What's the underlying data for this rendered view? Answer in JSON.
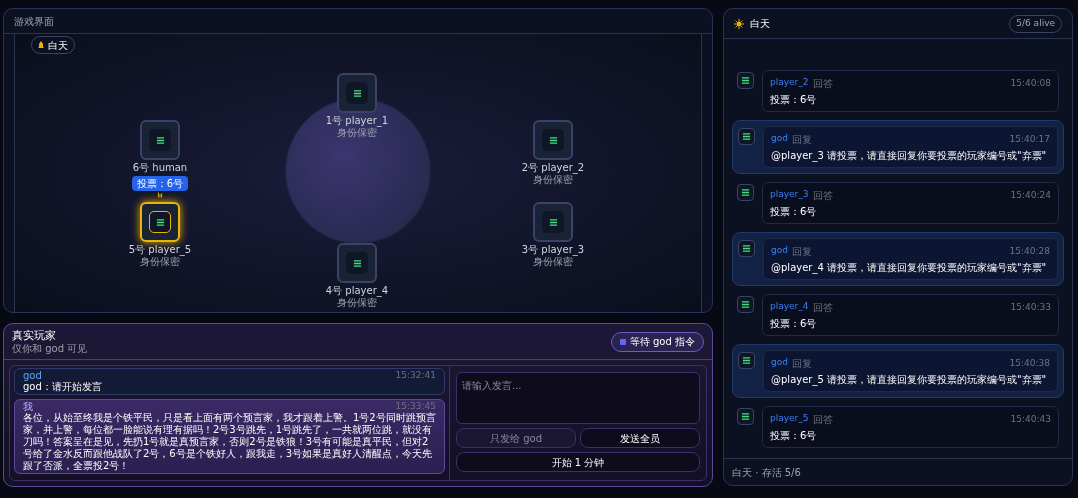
{
  "game_panel": {
    "title": "游戏界面",
    "phase_badge": "白天",
    "players": [
      {
        "name": "1号 player_1",
        "status": "身份保密",
        "speaking": false
      },
      {
        "name": "6号 human",
        "speaking": false,
        "bubble": "投票：6号"
      },
      {
        "name": "2号 player_2",
        "status": "身份保密",
        "speaking": false
      },
      {
        "name": "5号 player_5",
        "status": "身份保密",
        "speaking": true
      },
      {
        "name": "3号 player_3",
        "status": "身份保密",
        "speaking": false
      },
      {
        "name": "4号 player_4",
        "status": "身份保密",
        "speaking": false
      }
    ]
  },
  "human_panel": {
    "title": "真实玩家",
    "subtitle": "仅你和 god 可见",
    "status_badge": "等待 god 指令",
    "messages": [
      {
        "sender": "god",
        "time": "15:32:41",
        "text": "god：请开始发言",
        "kind": "god"
      },
      {
        "sender": "我",
        "time": "15:33:45",
        "text": "各位，从始至终我是个铁平民，只是看上面有两个预言家，我才跟着上警。1号2号同时跳预言家，并上警，每位都一脸能说有理有据吗！2号3号跳先，1号跳先了，一共就两位跳，就没有刀吗！答案呈在是见，先扔1号就是真预言家，否则2号是铁狼！3号有可能是真平民，但对2号给了金水反而跟他战队了2号，6号是个铁好人，跟我走，3号如果是真好人清醒点，今天先跟了否派，全票投2号！",
        "kind": "self"
      }
    ],
    "input_placeholder": "请输入发言...",
    "buttons": [
      "只发给 god",
      "发送全员",
      "开始 1 分钟"
    ]
  },
  "log_panel": {
    "title": "白天",
    "alive_badge": "5/6 alive",
    "entries": [
      {
        "sender": "player_2",
        "action": "回答",
        "time": "15:40:08",
        "text": "投票：6号",
        "kind": "player"
      },
      {
        "sender": "god",
        "action": "回复",
        "time": "15:40:17",
        "text": "@player_3 请投票，请直接回复你要投票的玩家编号或\"弃票\"",
        "kind": "god"
      },
      {
        "sender": "player_3",
        "action": "回答",
        "time": "15:40:24",
        "text": "投票：6号",
        "kind": "player"
      },
      {
        "sender": "god",
        "action": "回复",
        "time": "15:40:28",
        "text": "@player_4 请投票，请直接回复你要投票的玩家编号或\"弃票\"",
        "kind": "god"
      },
      {
        "sender": "player_4",
        "action": "回答",
        "time": "15:40:33",
        "text": "投票：6号",
        "kind": "player"
      },
      {
        "sender": "god",
        "action": "回复",
        "time": "15:40:38",
        "text": "@player_5 请投票，请直接回复你要投票的玩家编号或\"弃票\"",
        "kind": "god"
      },
      {
        "sender": "player_5",
        "action": "回答",
        "time": "15:40:43",
        "text": "投票：6号",
        "kind": "player"
      }
    ],
    "footer": "白天 · 存活 5/6"
  }
}
